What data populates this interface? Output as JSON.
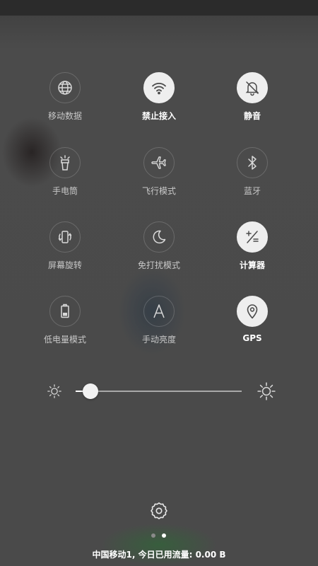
{
  "tiles": [
    {
      "label": "移动数据",
      "icon": "globe-icon",
      "on": false
    },
    {
      "label": "禁止接入",
      "icon": "wifi-icon",
      "on": true
    },
    {
      "label": "静音",
      "icon": "bell-off-icon",
      "on": true
    },
    {
      "label": "手电筒",
      "icon": "flashlight-icon",
      "on": false
    },
    {
      "label": "飞行模式",
      "icon": "airplane-icon",
      "on": false
    },
    {
      "label": "蓝牙",
      "icon": "bluetooth-icon",
      "on": false
    },
    {
      "label": "屏幕旋转",
      "icon": "rotate-icon",
      "on": false
    },
    {
      "label": "免打扰模式",
      "icon": "moon-icon",
      "on": false
    },
    {
      "label": "计算器",
      "icon": "calculator-icon",
      "on": true
    },
    {
      "label": "低电量模式",
      "icon": "battery-icon",
      "on": false
    },
    {
      "label": "手动亮度",
      "icon": "brightness-a-icon",
      "on": false
    },
    {
      "label": "GPS",
      "icon": "location-pin-icon",
      "on": true
    }
  ],
  "brightness": {
    "level": 0.09
  },
  "pager": {
    "pages": 2,
    "active": 1
  },
  "footer": {
    "status": "中国移动1, 今日已用流量: 0.00 B"
  },
  "colors": {
    "active_circle": "#eeeeee",
    "inactive_icon": "#d9d9d9",
    "background": "#4a4a4a"
  }
}
